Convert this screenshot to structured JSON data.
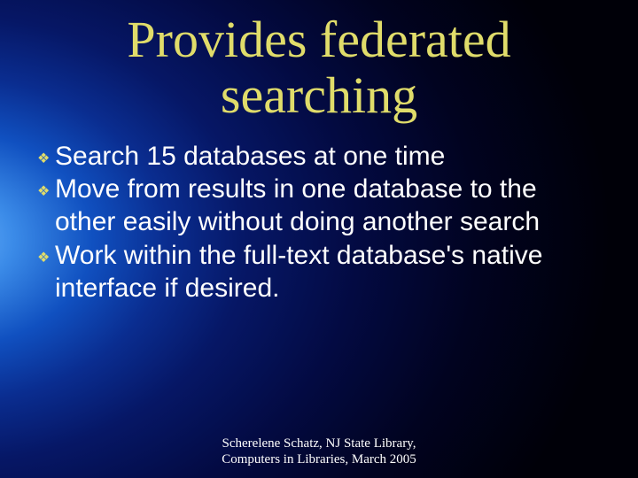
{
  "title_line1": "Provides federated",
  "title_line2": "searching",
  "bullets": [
    "Search 15 databases at one time",
    "Move from results in one database to the other easily without doing another search",
    "Work within the full-text database's native interface if desired."
  ],
  "footer_line1": "Scherelene Schatz, NJ State Library,",
  "footer_line2": "Computers in Libraries, March 2005"
}
